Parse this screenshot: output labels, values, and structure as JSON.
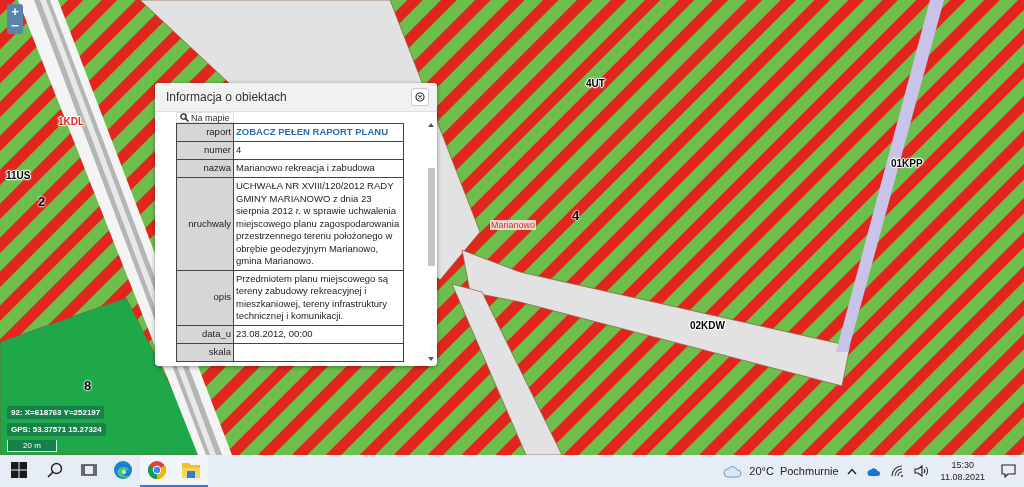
{
  "map": {
    "zoom_controls": [
      "+",
      "−"
    ],
    "labels": [
      {
        "text": "1KDL",
        "kind": "road"
      },
      {
        "text": "11US",
        "kind": "zone"
      },
      {
        "text": "2",
        "kind": "number"
      },
      {
        "text": "4UT",
        "kind": "zone"
      },
      {
        "text": "4",
        "kind": "number"
      },
      {
        "text": "Marianowo",
        "kind": "place"
      },
      {
        "text": "01KPP",
        "kind": "zone"
      },
      {
        "text": "02KDW",
        "kind": "zone"
      },
      {
        "text": "8",
        "kind": "number"
      }
    ],
    "coordinates": [
      "92: X=618763 Y=252197",
      "GPS: 53.37571 15.27324"
    ],
    "scale": "20 m"
  },
  "popup": {
    "title": "Informacja o obiektach",
    "locate_button": "Na mapie",
    "rows": [
      {
        "key": "raport",
        "value": "ZOBACZ PEŁEN RAPORT PLANU",
        "kind": "link"
      },
      {
        "key": "numer",
        "value": "4",
        "kind": "text"
      },
      {
        "key": "nazwa",
        "value": "Marianowo rekreacja i zabudowa",
        "kind": "text"
      },
      {
        "key": "nruchwaly",
        "value": "UCHWAŁA NR XVIII/120/2012 RADY GMINY MARIANOWO z dnia 23 sierpnia 2012 r. w sprawie uchwalenia miejscowego planu zagospodarowania przestrzennego terenu położonego w obrębie geodezyjnym Marianowo, gmina Marianowo.",
        "kind": "text"
      },
      {
        "key": "opis",
        "value": "Przedmiotem planu miejscowego są tereny zabudowy rekreacyjnej i mieszkaniowej, tereny infrastruktury technicznej i komunikacji.",
        "kind": "text"
      },
      {
        "key": "data_u",
        "value": "23.08.2012, 00:00",
        "kind": "text"
      },
      {
        "key": "skala"
      }
    ]
  },
  "taskbar": {
    "apps": [
      {
        "kind": "start",
        "running": false
      },
      {
        "kind": "search",
        "running": false
      },
      {
        "kind": "task-view",
        "running": false
      },
      {
        "kind": "edge",
        "running": false
      },
      {
        "kind": "chrome",
        "running": true
      },
      {
        "kind": "files",
        "running": true
      }
    ],
    "weather_temp": "20°C",
    "weather_text": "Pochmurnie",
    "tray": [
      {
        "kind": "caret"
      },
      {
        "kind": "cloud"
      },
      {
        "kind": "wifi"
      },
      {
        "kind": "speaker"
      }
    ],
    "time": "15:30",
    "date": "11.08.2021"
  }
}
